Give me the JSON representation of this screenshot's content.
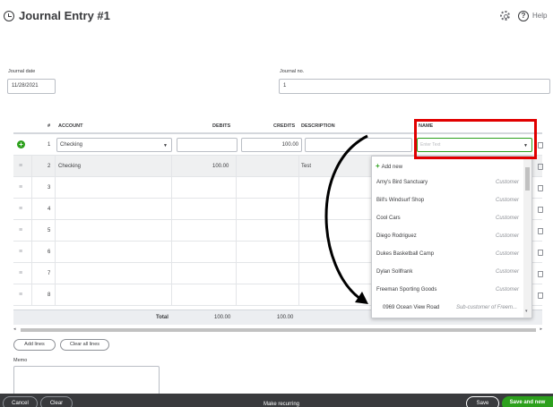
{
  "header": {
    "title": "Journal Entry #1",
    "help_label": "Help"
  },
  "form": {
    "journal_date_label": "Journal date",
    "journal_date_value": "11/28/2021",
    "journal_no_label": "Journal no.",
    "journal_no_value": "1"
  },
  "table": {
    "columns": [
      "#",
      "ACCOUNT",
      "DEBITS",
      "CREDITS",
      "DESCRIPTION",
      "NAME"
    ],
    "rows": [
      {
        "num": "1",
        "account": "Checking",
        "debit": "",
        "credit": "100.00",
        "description": "",
        "name_placeholder": "Enter Text"
      },
      {
        "num": "2",
        "account": "Checking",
        "debit": "100.00",
        "credit": "",
        "description": "Test",
        "name": ""
      },
      {
        "num": "3"
      },
      {
        "num": "4"
      },
      {
        "num": "5"
      },
      {
        "num": "6"
      },
      {
        "num": "7"
      },
      {
        "num": "8"
      }
    ],
    "total_label": "Total",
    "total_debits": "100.00",
    "total_credits": "100.00"
  },
  "name_dropdown": {
    "add_new": "Add new",
    "items": [
      {
        "name": "Amy's Bird Sanctuary",
        "type": "Customer"
      },
      {
        "name": "Bill's Windsurf Shop",
        "type": "Customer"
      },
      {
        "name": "Cool Cars",
        "type": "Customer"
      },
      {
        "name": "Diego Rodriguez",
        "type": "Customer"
      },
      {
        "name": "Dukes Basketball Camp",
        "type": "Customer"
      },
      {
        "name": "Dylan Sollfrank",
        "type": "Customer"
      },
      {
        "name": "Freeman Sporting Goods",
        "type": "Customer"
      },
      {
        "name": "0969 Ocean View Road",
        "type": "Sub-customer of Freem..."
      }
    ]
  },
  "buttons": {
    "add_lines": "Add lines",
    "clear_all_lines": "Clear all lines"
  },
  "memo_label": "Memo",
  "footer": {
    "cancel": "Cancel",
    "clear": "Clear",
    "make_recurring": "Make recurring",
    "save": "Save",
    "save_and_new": "Save and new"
  },
  "colors": {
    "accent_green": "#2ca01c",
    "highlight_red": "#e10000",
    "footer_bg": "#393a3d"
  }
}
